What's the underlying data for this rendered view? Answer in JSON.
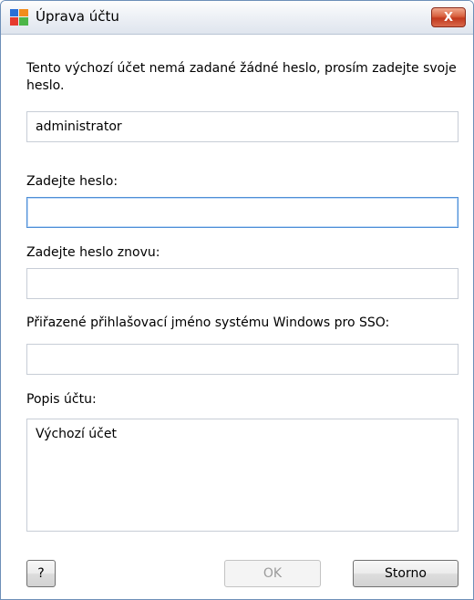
{
  "window": {
    "title": "Úprava účtu",
    "close_label": "X"
  },
  "intro_text": "Tento výchozí účet nemá zadané žádné heslo, prosím zadejte svoje heslo.",
  "fields": {
    "account_name": {
      "value": "administrator"
    },
    "password": {
      "label": "Zadejte heslo:",
      "value": ""
    },
    "password_repeat": {
      "label": "Zadejte heslo znovu:",
      "value": ""
    },
    "windows_login": {
      "label": "Přiřazené přihlašovací jméno systému Windows pro SSO:",
      "value": ""
    },
    "description": {
      "label": "Popis účtu:",
      "value": "Výchozí účet"
    }
  },
  "buttons": {
    "help": "?",
    "ok": "OK",
    "cancel": "Storno"
  },
  "colors": {
    "focus_border": "#4f8fd6",
    "close_button": "#c2391d"
  }
}
